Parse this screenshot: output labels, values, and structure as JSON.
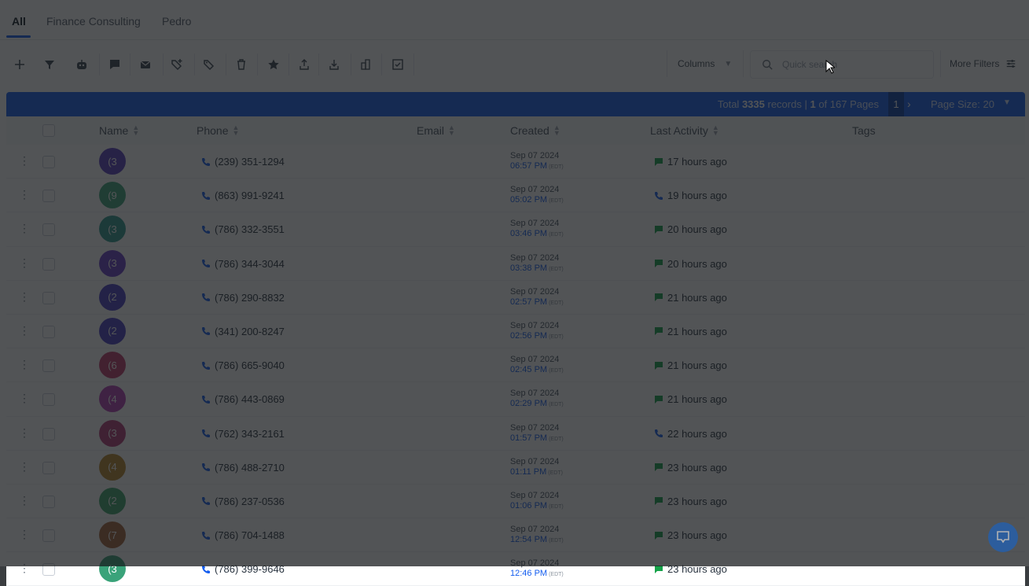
{
  "tabs": [
    {
      "label": "All",
      "active": true
    },
    {
      "label": "Finance Consulting",
      "active": false
    },
    {
      "label": "Pedro",
      "active": false
    }
  ],
  "toolbar": {
    "icons": [
      "add-icon",
      "filter-icon",
      "robot-icon",
      "sms-icon",
      "email-icon",
      "add-tag-icon",
      "tag-icon",
      "delete-icon",
      "star-icon",
      "export-icon",
      "import-icon",
      "merge-icon",
      "review-icon"
    ],
    "columns_label": "Columns",
    "search_placeholder": "Quick search",
    "more_filters_label": "More Filters"
  },
  "pager": {
    "total_prefix": "Total",
    "total_records": "3335",
    "records_of": "records |",
    "current_page": "1",
    "of_label": "of",
    "total_pages": "167",
    "pages_label": "Pages",
    "page_button": "1",
    "page_size_label": "Page Size: 20"
  },
  "table": {
    "columns": [
      "Name",
      "Phone",
      "Email",
      "Created",
      "Last Activity",
      "Tags"
    ],
    "rows": [
      {
        "initials": "(3",
        "avatar_color": "#5b3fc2",
        "phone": "(239) 351-1294",
        "created_date": "Sep 07 2024",
        "created_time": "06:57 PM",
        "tz": "(EDT)",
        "activity_icon": "message",
        "activity": "17 hours ago"
      },
      {
        "initials": "(9",
        "avatar_color": "#3fa67e",
        "phone": "(863) 991-9241",
        "created_date": "Sep 07 2024",
        "created_time": "05:02 PM",
        "tz": "(EDT)",
        "activity_icon": "phone",
        "activity": "19 hours ago"
      },
      {
        "initials": "(3",
        "avatar_color": "#2f9b8f",
        "phone": "(786) 332-3551",
        "created_date": "Sep 07 2024",
        "created_time": "03:46 PM",
        "tz": "(EDT)",
        "activity_icon": "message",
        "activity": "20 hours ago"
      },
      {
        "initials": "(3",
        "avatar_color": "#6a3ec8",
        "phone": "(786) 344-3044",
        "created_date": "Sep 07 2024",
        "created_time": "03:38 PM",
        "tz": "(EDT)",
        "activity_icon": "message",
        "activity": "20 hours ago"
      },
      {
        "initials": "(2",
        "avatar_color": "#4b3fc4",
        "phone": "(786) 290-8832",
        "created_date": "Sep 07 2024",
        "created_time": "02:57 PM",
        "tz": "(EDT)",
        "activity_icon": "message",
        "activity": "21 hours ago"
      },
      {
        "initials": "(2",
        "avatar_color": "#4b3fc4",
        "phone": "(341) 200-8247",
        "created_date": "Sep 07 2024",
        "created_time": "02:56 PM",
        "tz": "(EDT)",
        "activity_icon": "message",
        "activity": "21 hours ago"
      },
      {
        "initials": "(6",
        "avatar_color": "#c23a6b",
        "phone": "(786) 665-9040",
        "created_date": "Sep 07 2024",
        "created_time": "02:45 PM",
        "tz": "(EDT)",
        "activity_icon": "message",
        "activity": "21 hours ago"
      },
      {
        "initials": "(4",
        "avatar_color": "#b43fb6",
        "phone": "(786) 443-0869",
        "created_date": "Sep 07 2024",
        "created_time": "02:29 PM",
        "tz": "(EDT)",
        "activity_icon": "message",
        "activity": "21 hours ago"
      },
      {
        "initials": "(3",
        "avatar_color": "#b43a7a",
        "phone": "(762) 343-2161",
        "created_date": "Sep 07 2024",
        "created_time": "01:57 PM",
        "tz": "(EDT)",
        "activity_icon": "phone",
        "activity": "22 hours ago"
      },
      {
        "initials": "(4",
        "avatar_color": "#b8862b",
        "phone": "(786) 488-2710",
        "created_date": "Sep 07 2024",
        "created_time": "01:11 PM",
        "tz": "(EDT)",
        "activity_icon": "message",
        "activity": "23 hours ago"
      },
      {
        "initials": "(2",
        "avatar_color": "#3fa66b",
        "phone": "(786) 237-0536",
        "created_date": "Sep 07 2024",
        "created_time": "01:06 PM",
        "tz": "(EDT)",
        "activity_icon": "message",
        "activity": "23 hours ago"
      },
      {
        "initials": "(7",
        "avatar_color": "#a8643a",
        "phone": "(786) 704-1488",
        "created_date": "Sep 07 2024",
        "created_time": "12:54 PM",
        "tz": "(EDT)",
        "activity_icon": "message",
        "activity": "23 hours ago"
      },
      {
        "initials": "(3",
        "avatar_color": "#3aa37a",
        "phone": "(786) 399-9646",
        "created_date": "Sep 07 2024",
        "created_time": "12:46 PM",
        "tz": "(EDT)",
        "activity_icon": "message",
        "activity": "23 hours ago"
      }
    ]
  },
  "colors": {
    "accent": "#155eef",
    "message_green": "#16a34a",
    "overlay": "#16181b"
  }
}
